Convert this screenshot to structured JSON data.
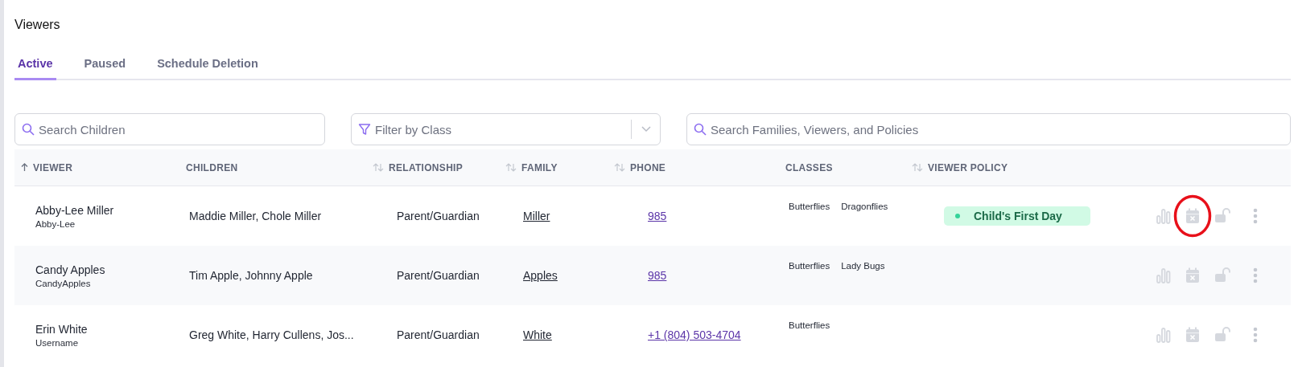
{
  "title": "Viewers",
  "tabs": [
    {
      "label": "Active",
      "selected": true
    },
    {
      "label": "Paused",
      "selected": false
    },
    {
      "label": "Schedule Deletion",
      "selected": false
    }
  ],
  "filters": [
    {
      "kind": "search",
      "placeholder": "Search Children"
    },
    {
      "kind": "select",
      "placeholder": "Filter by Class"
    },
    {
      "kind": "search",
      "placeholder": "Search Families, Viewers, and Policies"
    }
  ],
  "table": {
    "columns": [
      {
        "label": "VIEWER",
        "sorted": true
      },
      {
        "label": "CHILDREN",
        "sortable": false,
        "sorted": false
      },
      {
        "label": "RELATIONSHIP",
        "sortable": true,
        "sorted": false
      },
      {
        "label": "FAMILY",
        "sortable": true,
        "sorted": false
      },
      {
        "label": "PHONE",
        "sortable": true,
        "sorted": false
      },
      {
        "label": "CLASSES",
        "sortable": false,
        "sorted": false
      },
      {
        "label": "VIEWER POLICY",
        "sortable": true,
        "sorted": false
      }
    ],
    "rows": [
      {
        "viewer": "Abby-Lee Miller",
        "username": "Abby-Lee",
        "children": "Maddie Miller, Chole Miller",
        "relationship": "Parent/Guardian",
        "family": "Miller",
        "phone": "985",
        "classes": [
          "Butterflies",
          "Dragonflies"
        ],
        "policy": "Child's First Day",
        "circled": true
      },
      {
        "viewer": "Candy Apples",
        "username": "CandyApples",
        "children": "Tim Apple, Johnny Apple",
        "relationship": "Parent/Guardian",
        "family": "Apples",
        "phone": "985",
        "classes": [
          "Butterflies",
          "Lady Bugs"
        ],
        "circled": false
      },
      {
        "viewer": "Erin White",
        "username": "Username",
        "children": "Greg White, Harry Cullens, Jos...",
        "relationship": "Parent/Guardian",
        "family": "White",
        "phone": "+1 (804) 503-4704",
        "classes": [
          "Butterflies"
        ],
        "circled": false
      }
    ]
  }
}
